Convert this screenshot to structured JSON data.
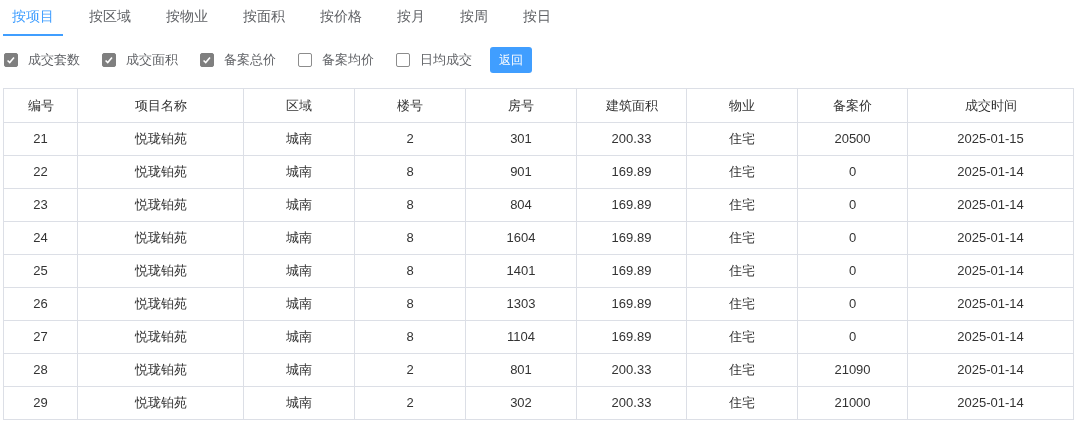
{
  "tabs": [
    {
      "label": "按项目",
      "selected": true
    },
    {
      "label": "按区域",
      "selected": false
    },
    {
      "label": "按物业",
      "selected": false
    },
    {
      "label": "按面积",
      "selected": false
    },
    {
      "label": "按价格",
      "selected": false
    },
    {
      "label": "按月",
      "selected": false
    },
    {
      "label": "按周",
      "selected": false
    },
    {
      "label": "按日",
      "selected": false
    }
  ],
  "options": [
    {
      "label": "成交套数",
      "checked": true
    },
    {
      "label": "成交面积",
      "checked": true
    },
    {
      "label": "备案总价",
      "checked": true
    },
    {
      "label": "备案均价",
      "checked": false
    },
    {
      "label": "日均成交",
      "checked": false
    }
  ],
  "back_button": "返回",
  "table": {
    "columns": [
      "编号",
      "项目名称",
      "区域",
      "楼号",
      "房号",
      "建筑面积",
      "物业",
      "备案价",
      "成交时间"
    ],
    "rows": [
      [
        "21",
        "悦珑铂苑",
        "城南",
        "2",
        "301",
        "200.33",
        "住宅",
        "20500",
        "2025-01-15"
      ],
      [
        "22",
        "悦珑铂苑",
        "城南",
        "8",
        "901",
        "169.89",
        "住宅",
        "0",
        "2025-01-14"
      ],
      [
        "23",
        "悦珑铂苑",
        "城南",
        "8",
        "804",
        "169.89",
        "住宅",
        "0",
        "2025-01-14"
      ],
      [
        "24",
        "悦珑铂苑",
        "城南",
        "8",
        "1604",
        "169.89",
        "住宅",
        "0",
        "2025-01-14"
      ],
      [
        "25",
        "悦珑铂苑",
        "城南",
        "8",
        "1401",
        "169.89",
        "住宅",
        "0",
        "2025-01-14"
      ],
      [
        "26",
        "悦珑铂苑",
        "城南",
        "8",
        "1303",
        "169.89",
        "住宅",
        "0",
        "2025-01-14"
      ],
      [
        "27",
        "悦珑铂苑",
        "城南",
        "8",
        "1104",
        "169.89",
        "住宅",
        "0",
        "2025-01-14"
      ],
      [
        "28",
        "悦珑铂苑",
        "城南",
        "2",
        "801",
        "200.33",
        "住宅",
        "21090",
        "2025-01-14"
      ],
      [
        "29",
        "悦珑铂苑",
        "城南",
        "2",
        "302",
        "200.33",
        "住宅",
        "21000",
        "2025-01-14"
      ]
    ]
  }
}
